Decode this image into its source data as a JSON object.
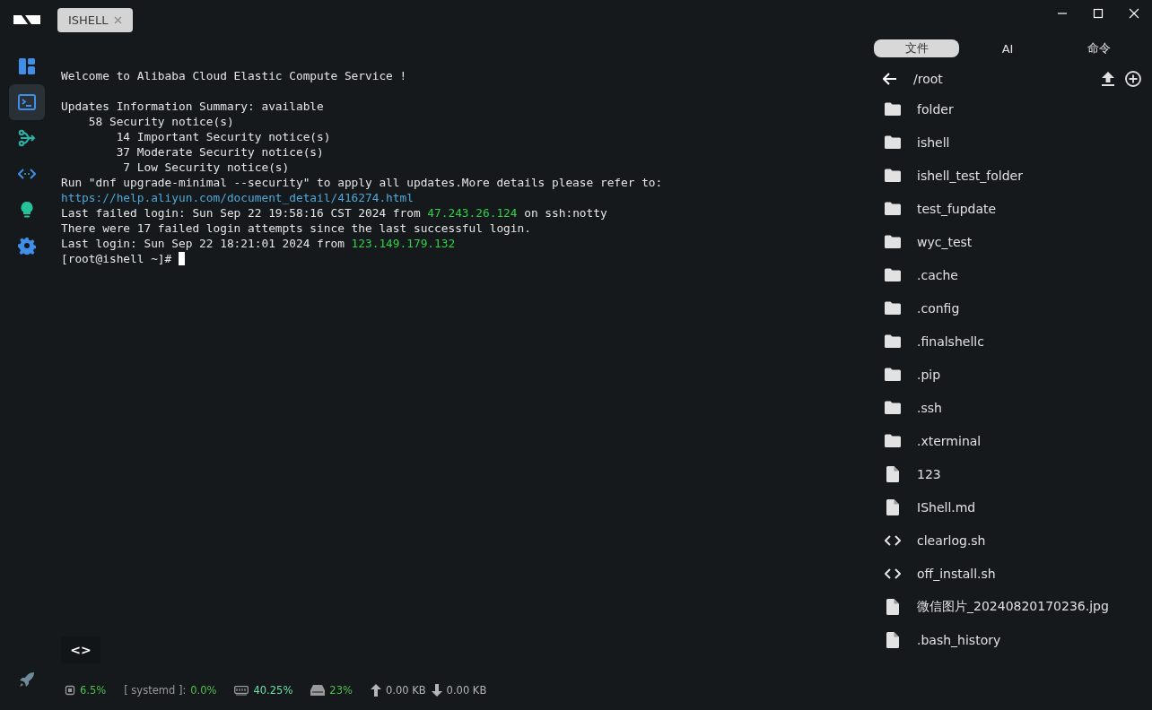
{
  "sidebar": {
    "items": [
      {
        "kind": "dashboard",
        "selected": false
      },
      {
        "kind": "terminal",
        "selected": true
      },
      {
        "kind": "flow",
        "selected": false
      },
      {
        "kind": "code",
        "selected": false
      },
      {
        "kind": "idea",
        "selected": false
      },
      {
        "kind": "settings",
        "selected": false
      }
    ],
    "bottom_item": {
      "kind": "rocket"
    }
  },
  "tabs": [
    {
      "label": "ISHELL",
      "selected": true,
      "closable": true
    }
  ],
  "terminal": {
    "lines": [
      [
        {
          "kind": "plain",
          "text": "Welcome to Alibaba Cloud Elastic Compute Service !"
        }
      ],
      [
        {
          "kind": "blank"
        }
      ],
      [
        {
          "kind": "plain",
          "text": "Updates Information Summary: available"
        }
      ],
      [
        {
          "kind": "plain",
          "text": "    58 Security notice(s)"
        }
      ],
      [
        {
          "kind": "plain",
          "text": "        14 Important Security notice(s)"
        }
      ],
      [
        {
          "kind": "plain",
          "text": "        37 Moderate Security notice(s)"
        }
      ],
      [
        {
          "kind": "plain",
          "text": "         7 Low Security notice(s)"
        }
      ],
      [
        {
          "kind": "plain",
          "text": "Run \"dnf upgrade-minimal --security\" to apply all updates.More details please refer to:"
        }
      ],
      [
        {
          "kind": "link",
          "text": "https://help.aliyun.com/document_detail/416274.html"
        }
      ],
      [
        {
          "kind": "plain",
          "text": "Last failed login: Sun Sep 22 19:58:16 CST 2024 from "
        },
        {
          "kind": "ip",
          "text": "47.243.26.124"
        },
        {
          "kind": "plain",
          "text": " on ssh:notty"
        }
      ],
      [
        {
          "kind": "plain",
          "text": "There were 17 failed login attempts since the last successful login."
        }
      ],
      [
        {
          "kind": "plain",
          "text": "Last login: Sun Sep 22 18:21:01 2024 from "
        },
        {
          "kind": "ip",
          "text": "123.149.179.132"
        }
      ],
      [
        {
          "kind": "plain",
          "text": "[root@ishell ~]# "
        },
        {
          "kind": "cursor"
        }
      ]
    ],
    "code_toggle": "<>"
  },
  "status_bar": [
    {
      "kind": "cpu",
      "value": "6.5%"
    },
    {
      "kind": "process",
      "label": "[ systemd ]:",
      "value": "0.0%"
    },
    {
      "kind": "memory",
      "value": "40.25%"
    },
    {
      "kind": "disk",
      "value": "23%"
    },
    {
      "kind": "upload",
      "value": "0.00 KB"
    },
    {
      "kind": "download",
      "value": "0.00 KB"
    }
  ],
  "panel": {
    "tabs": [
      {
        "label": "文件",
        "selected": true
      },
      {
        "label": "AI",
        "selected": false
      },
      {
        "label": "命令",
        "selected": false
      }
    ],
    "path": "/root",
    "files": [
      {
        "kind": "folder",
        "name": "folder"
      },
      {
        "kind": "folder",
        "name": "ishell"
      },
      {
        "kind": "folder",
        "name": "ishell_test_folder"
      },
      {
        "kind": "folder",
        "name": "test_fupdate"
      },
      {
        "kind": "folder",
        "name": "wyc_test"
      },
      {
        "kind": "folder",
        "name": ".cache"
      },
      {
        "kind": "folder",
        "name": ".config"
      },
      {
        "kind": "folder",
        "name": ".finalshellc"
      },
      {
        "kind": "folder",
        "name": ".pip"
      },
      {
        "kind": "folder",
        "name": ".ssh"
      },
      {
        "kind": "folder",
        "name": ".xterminal"
      },
      {
        "kind": "file",
        "name": "123"
      },
      {
        "kind": "file",
        "name": "IShell.md"
      },
      {
        "kind": "script",
        "name": "clearlog.sh"
      },
      {
        "kind": "script",
        "name": "off_install.sh"
      },
      {
        "kind": "file",
        "name": "微信图片_20240820170236.jpg"
      },
      {
        "kind": "file",
        "name": ".bash_history"
      }
    ]
  }
}
